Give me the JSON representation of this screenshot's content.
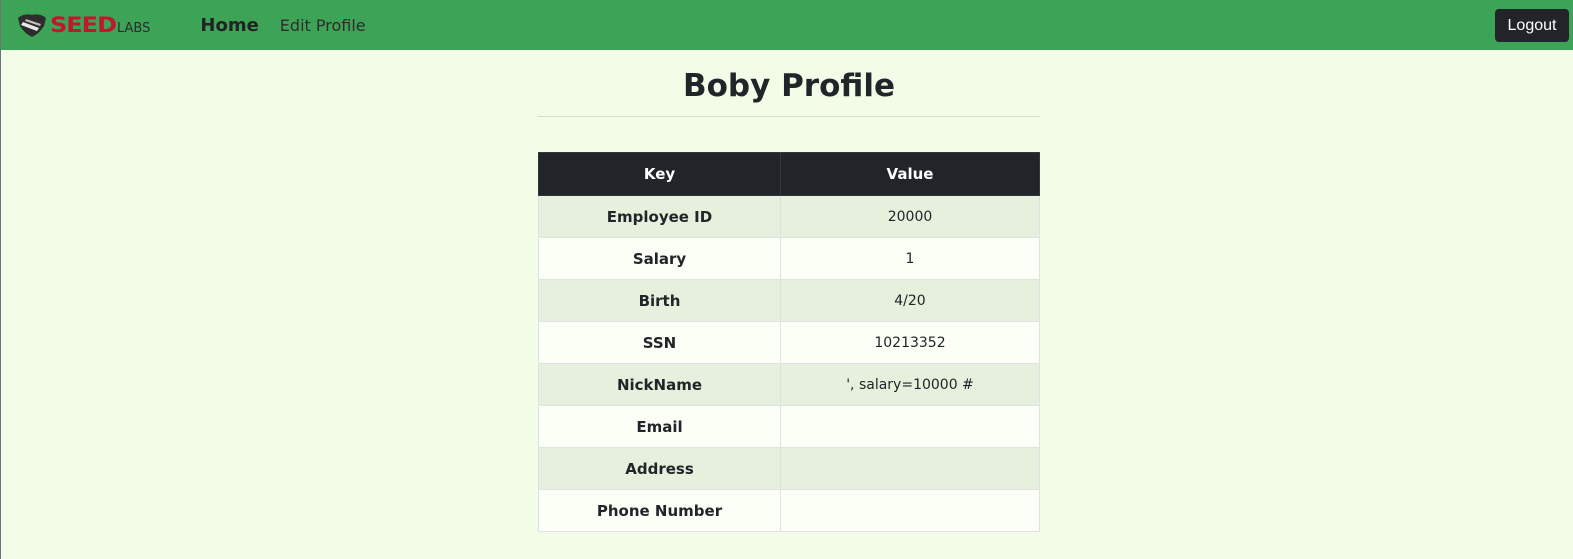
{
  "nav": {
    "brand_seed": "SEED",
    "brand_labs": "LABS",
    "home_label": "Home",
    "edit_label": "Edit Profile",
    "logout_label": "Logout"
  },
  "profile": {
    "title": "Boby Profile",
    "headers": [
      "Key",
      "Value"
    ],
    "rows": [
      {
        "key": "Employee ID",
        "value": "20000"
      },
      {
        "key": "Salary",
        "value": "1"
      },
      {
        "key": "Birth",
        "value": "4/20"
      },
      {
        "key": "SSN",
        "value": "10213352"
      },
      {
        "key": "NickName",
        "value": "', salary=10000 #"
      },
      {
        "key": "Email",
        "value": ""
      },
      {
        "key": "Address",
        "value": ""
      },
      {
        "key": "Phone Number",
        "value": ""
      }
    ]
  },
  "colors": {
    "navbar": "#3da356",
    "background": "#f2fce6",
    "header_dark": "#212529",
    "brand_red": "#c0182a"
  },
  "icons": {
    "logo": "seedlabs-shield-icon"
  }
}
